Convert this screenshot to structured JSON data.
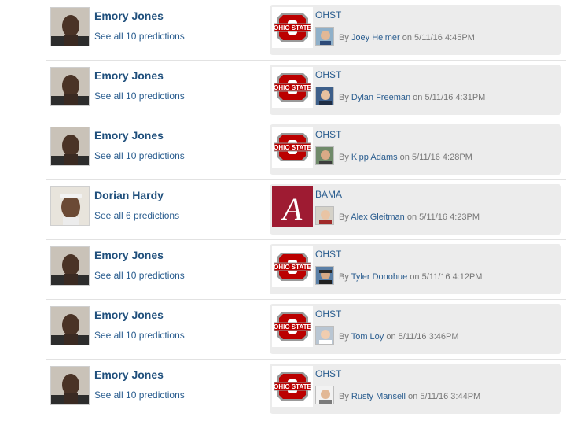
{
  "rows": [
    {
      "player": "Emory Jones",
      "predictions": "See all 10 predictions",
      "team": "OHST",
      "by": "By",
      "author": "Joey Helmer",
      "on": "on",
      "time": "5/11/16 4:45PM"
    },
    {
      "player": "Emory Jones",
      "predictions": "See all 10 predictions",
      "team": "OHST",
      "by": "By",
      "author": "Dylan Freeman",
      "on": "on",
      "time": "5/11/16 4:31PM"
    },
    {
      "player": "Emory Jones",
      "predictions": "See all 10 predictions",
      "team": "OHST",
      "by": "By",
      "author": "Kipp Adams",
      "on": "on",
      "time": "5/11/16 4:28PM"
    },
    {
      "player": "Dorian Hardy",
      "predictions": "See all 6 predictions",
      "team": "BAMA",
      "by": "By",
      "author": "Alex Gleitman",
      "on": "on",
      "time": "5/11/16 4:23PM"
    },
    {
      "player": "Emory Jones",
      "predictions": "See all 10 predictions",
      "team": "OHST",
      "by": "By",
      "author": "Tyler Donohue",
      "on": "on",
      "time": "5/11/16 4:12PM"
    },
    {
      "player": "Emory Jones",
      "predictions": "See all 10 predictions",
      "team": "OHST",
      "by": "By",
      "author": "Tom Loy",
      "on": "on",
      "time": "5/11/16 3:46PM"
    },
    {
      "player": "Emory Jones",
      "predictions": "See all 10 predictions",
      "team": "OHST",
      "by": "By",
      "author": "Rusty Mansell",
      "on": "on",
      "time": "5/11/16 3:44PM"
    }
  ],
  "logos": {
    "ohst": {
      "text": "OHIO STATE",
      "red": "#bb0000",
      "gray": "#9a9a9a"
    },
    "bama": {
      "letter": "A",
      "crimson": "#9e1b32"
    }
  },
  "colors": {
    "link": "#2a5d8f",
    "name": "#1f4f7c",
    "card": "#ececec"
  }
}
